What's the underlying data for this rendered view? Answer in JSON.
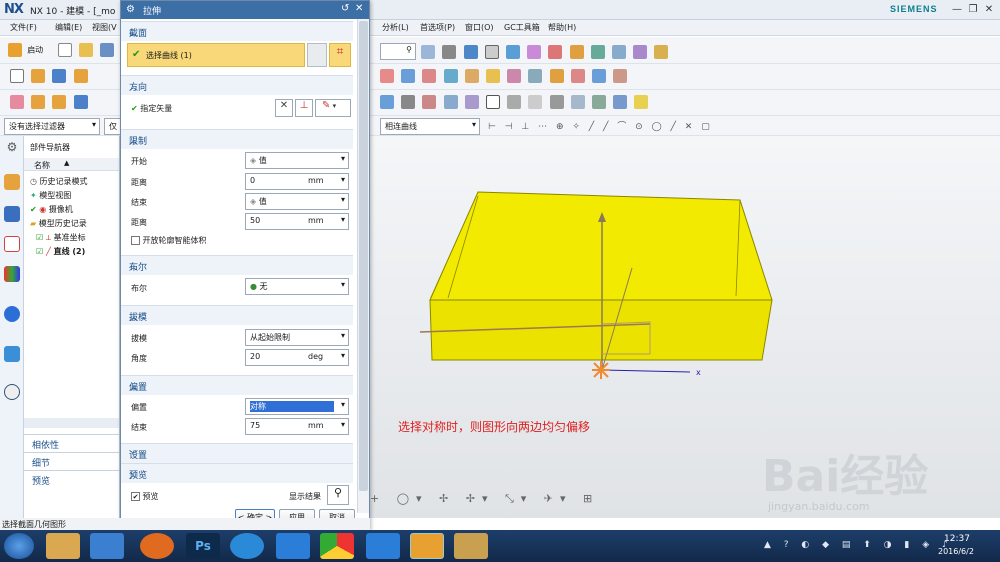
{
  "window": {
    "logo": "NX",
    "title": "NX 10 - 建模 - [_mo",
    "brand": "SIEMENS"
  },
  "menubar": {
    "left_items": [
      "文件(F)",
      "编辑(E)",
      "视图(V"
    ],
    "right_items": [
      "分析(L)",
      "首选项(P)",
      "窗口(O)",
      "GC工具箱",
      "帮助(H)"
    ]
  },
  "toolbar": {
    "start_label": "启动",
    "filter_label": "没有选择过滤器",
    "filter2_label": "仅",
    "curve_rule": "相连曲线"
  },
  "navigator": {
    "title": "部件导航器",
    "column_name": "名称",
    "items": [
      "历史记录模式",
      "模型视图",
      "摄像机",
      "模型历史记录",
      "基准坐标",
      "直线 (2)"
    ],
    "bottom_panels": [
      "相依性",
      "细节",
      "预览"
    ]
  },
  "dialog": {
    "title": "拉伸",
    "section": {
      "header": "截面",
      "select_curve": "选择曲线 (1)"
    },
    "direction": {
      "header": "方向",
      "specify_vector": "指定矢量"
    },
    "limits": {
      "header": "限制",
      "start_label": "开始",
      "start_value": "值",
      "distance1_label": "距离",
      "distance1_value": "0",
      "distance1_unit": "mm",
      "end_label": "结束",
      "end_value": "值",
      "distance2_label": "距离",
      "distance2_value": "50",
      "distance2_unit": "mm",
      "open_profile": "开放轮廓智能体积"
    },
    "boolean": {
      "header": "布尔",
      "label": "布尔",
      "value": "无"
    },
    "draft": {
      "header": "拔模",
      "label": "拔模",
      "value": "从起始限制",
      "angle_label": "角度",
      "angle_value": "20",
      "angle_unit": "deg"
    },
    "offset": {
      "header": "偏置",
      "label": "偏置",
      "value": "对称",
      "end_label": "结束",
      "end_value": "75",
      "end_unit": "mm"
    },
    "settings": {
      "header": "设置"
    },
    "preview": {
      "header": "预览",
      "checkbox": "预览",
      "show_result": "显示结果"
    },
    "buttons": {
      "ok": "< 确定 >",
      "apply": "应用",
      "cancel": "取消"
    }
  },
  "annotation": "选择对称时，则图形向两边均匀偏移",
  "statusbar": {
    "text": "选择截面几何图形"
  },
  "clock": {
    "time": "12:37",
    "date": "2016/6/2"
  },
  "watermark": {
    "main": "Bai经验",
    "sub": "jingyan.baidu.com"
  },
  "colors": {
    "solid": "#f2ea00",
    "dialog_title": "#3c6fa6",
    "highlight": "#2f6fd6",
    "annotation": "#e02020"
  }
}
